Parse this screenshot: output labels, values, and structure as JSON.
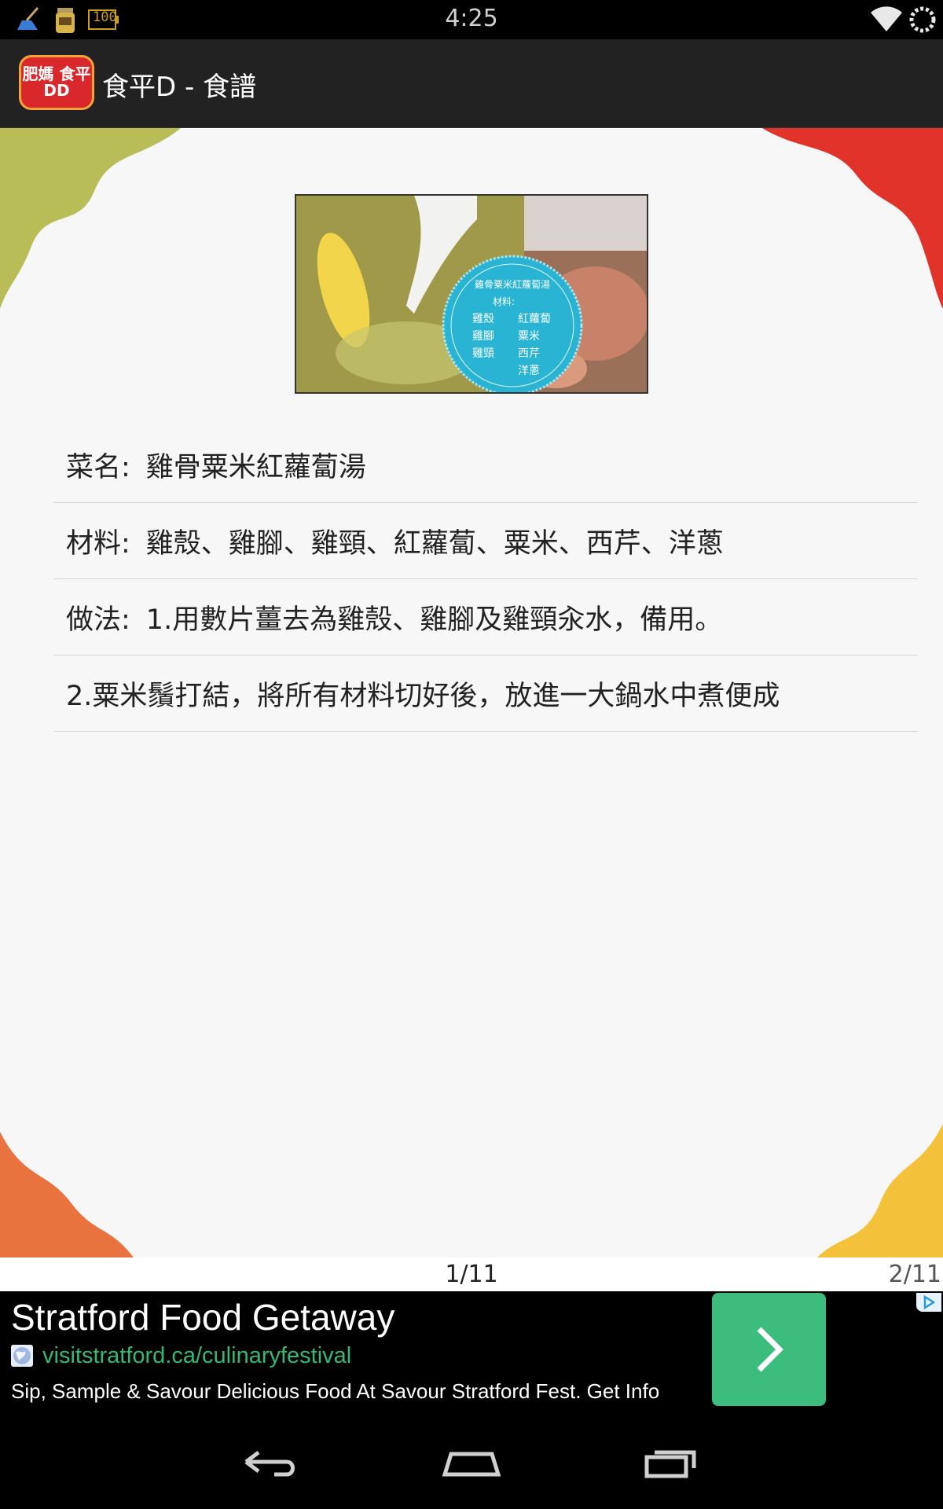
{
  "status_bar": {
    "time": "4:25",
    "battery_text": "100",
    "icons": [
      "broom-icon",
      "jar-icon",
      "battery-icon",
      "wifi-icon",
      "sync-icon"
    ]
  },
  "action_bar": {
    "logo_text": "肥媽 食平DD",
    "title": "食平D  -  食譜"
  },
  "recipe": {
    "image_label": "雞骨粟米紅蘿蔔湯",
    "image_ingredients_heading": "材料:",
    "image_ingredients": [
      "雞殼",
      "紅蘿蔔",
      "雞腳",
      "粟米",
      "雞頸",
      "西芹",
      "洋蔥"
    ],
    "rows": [
      {
        "label": "菜名:",
        "value": "雞骨粟米紅蘿蔔湯"
      },
      {
        "label": "材料:",
        "value": "雞殼、雞腳、雞頸、紅蘿蔔、粟米、西芹、洋蔥"
      },
      {
        "label": "做法:",
        "value": "1.用數片薑去為雞殼、雞腳及雞頸汆水，備用。"
      },
      {
        "label": "",
        "value": "2.粟米鬚打結，將所有材料切好後，放進一大鍋水中煮便成"
      }
    ]
  },
  "pager": {
    "current": "1/11",
    "next": "2/11"
  },
  "ad": {
    "title": "Stratford Food Getaway",
    "url": "visitstratford.ca/culinaryfestival",
    "description": "Sip, Sample & Savour Delicious Food At Savour Stratford Fest. Get Info",
    "accent": "#3dbd7d"
  },
  "nav_bar": {
    "buttons": [
      "back-icon",
      "home-icon",
      "recents-icon"
    ]
  }
}
